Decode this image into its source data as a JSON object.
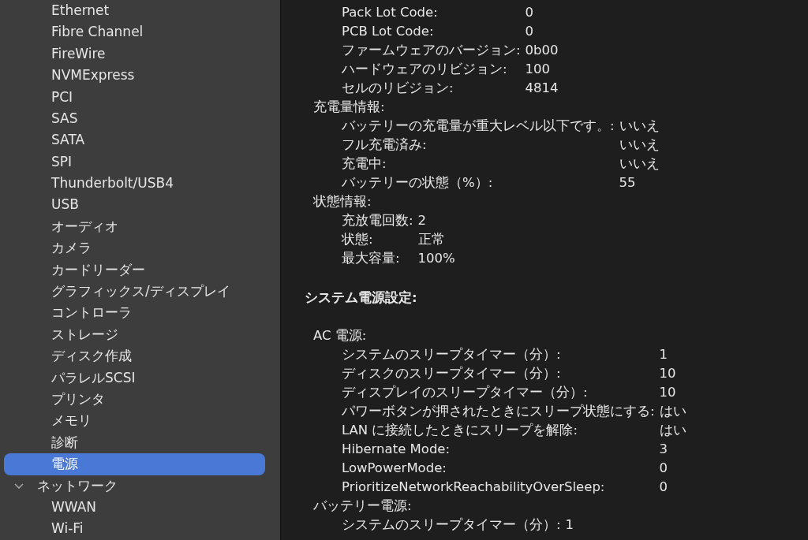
{
  "sidebar": {
    "items": [
      {
        "label": "Ethernet",
        "selected": false
      },
      {
        "label": "Fibre Channel",
        "selected": false
      },
      {
        "label": "FireWire",
        "selected": false
      },
      {
        "label": "NVMExpress",
        "selected": false
      },
      {
        "label": "PCI",
        "selected": false
      },
      {
        "label": "SAS",
        "selected": false
      },
      {
        "label": "SATA",
        "selected": false
      },
      {
        "label": "SPI",
        "selected": false
      },
      {
        "label": "Thunderbolt/USB4",
        "selected": false
      },
      {
        "label": "USB",
        "selected": false
      },
      {
        "label": "オーディオ",
        "selected": false
      },
      {
        "label": "カメラ",
        "selected": false
      },
      {
        "label": "カードリーダー",
        "selected": false
      },
      {
        "label": "グラフィックス/ディスプレイ",
        "selected": false
      },
      {
        "label": "コントローラ",
        "selected": false
      },
      {
        "label": "ストレージ",
        "selected": false
      },
      {
        "label": "ディスク作成",
        "selected": false
      },
      {
        "label": "パラレルSCSI",
        "selected": false
      },
      {
        "label": "プリンタ",
        "selected": false
      },
      {
        "label": "メモリ",
        "selected": false
      },
      {
        "label": "診断",
        "selected": false
      },
      {
        "label": "電源",
        "selected": true
      },
      {
        "label": "ネットワーク",
        "selected": false,
        "expanded": true,
        "children": [
          {
            "label": "WWAN",
            "selected": false
          },
          {
            "label": "Wi-Fi",
            "selected": false
          }
        ]
      }
    ]
  },
  "content": {
    "blocks": [
      {
        "kind": "group",
        "rows": [
          {
            "label": "Pack Lot Code:",
            "value": "0"
          },
          {
            "label": "PCB Lot Code:",
            "value": "0"
          },
          {
            "label": "ファームウェアのバージョン:",
            "value": "0b00"
          },
          {
            "label": "ハードウェアのリビジョン:",
            "value": "100"
          },
          {
            "label": "セルのリビジョン:",
            "value": "4814"
          }
        ]
      },
      {
        "kind": "group",
        "heading": "充電量情報:",
        "rows": [
          {
            "label": "バッテリーの充電量が重大レベル以下です。:",
            "value": "いいえ"
          },
          {
            "label": "フル充電済み:",
            "value": "いいえ"
          },
          {
            "label": "充電中:",
            "value": "いいえ"
          },
          {
            "label": "バッテリーの状態（%）:",
            "value": "55"
          }
        ]
      },
      {
        "kind": "group",
        "heading": "状態情報:",
        "rows": [
          {
            "label": "充放電回数:",
            "value": "2"
          },
          {
            "label": "状態:",
            "value": "正常"
          },
          {
            "label": "最大容量:",
            "value": "100%"
          }
        ]
      },
      {
        "kind": "section",
        "heading": "システム電源設定:"
      },
      {
        "kind": "group",
        "heading": "AC 電源:",
        "rows": [
          {
            "label": "システムのスリープタイマー（分）:",
            "value": "1"
          },
          {
            "label": "ディスクのスリープタイマー（分）:",
            "value": "10"
          },
          {
            "label": "ディスプレイのスリープタイマー（分）:",
            "value": "10"
          },
          {
            "label": "パワーボタンが押されたときにスリープ状態にする:",
            "value": "はい"
          },
          {
            "label": "LAN に接続したときにスリープを解除:",
            "value": "はい"
          },
          {
            "label": "Hibernate Mode:",
            "value": "3"
          },
          {
            "label": "LowPowerMode:",
            "value": "0"
          },
          {
            "label": "PrioritizeNetworkReachabilityOverSleep:",
            "value": "0"
          }
        ]
      },
      {
        "kind": "group",
        "heading": "バッテリー電源:",
        "rows": [
          {
            "label": "システムのスリープタイマー（分）:",
            "value": "1"
          }
        ]
      }
    ]
  }
}
